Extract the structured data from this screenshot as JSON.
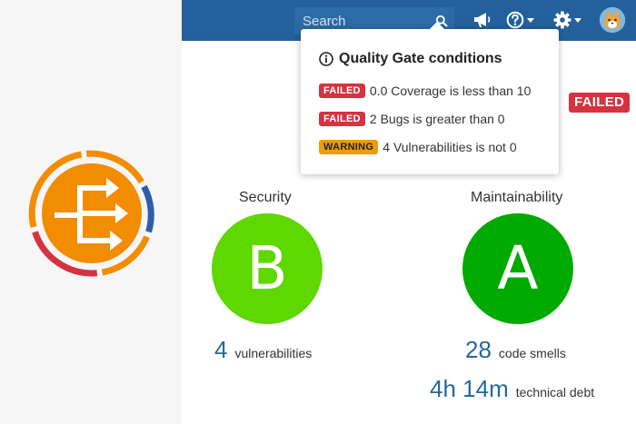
{
  "topbar": {
    "search": {
      "placeholder": "Search",
      "value": ""
    },
    "icons": [
      "megaphone-icon",
      "help-icon",
      "gear-icon"
    ],
    "avatar": "user-avatar"
  },
  "quality_gate": {
    "popup": {
      "title": "Quality Gate conditions",
      "conditions": [
        {
          "badge": "FAILED",
          "text": "0.0 Coverage is less than 10"
        },
        {
          "badge": "FAILED",
          "text": "2 Bugs is greater than 0"
        },
        {
          "badge": "WARNING",
          "text": "4 Vulnerabilities is not 0"
        }
      ]
    },
    "status": "FAILED"
  },
  "metrics": {
    "security": {
      "title": "Security",
      "rating": "B",
      "value": "4",
      "label": "vulnerabilities"
    },
    "maintainability": {
      "title": "Maintainability",
      "rating": "A",
      "value": "28",
      "label": "code smells",
      "debt_value": "4h 14m",
      "debt_label": "technical debt"
    }
  },
  "colors": {
    "topbar": "#23609c",
    "failed": "#d4333f",
    "warning": "#ed9c0a",
    "rating_a": "#00aa00",
    "rating_b": "#5fd700",
    "link": "#236a97",
    "logo_orange": "#f28c00",
    "logo_blue": "#2e5eaa",
    "logo_red": "#d4333f"
  }
}
